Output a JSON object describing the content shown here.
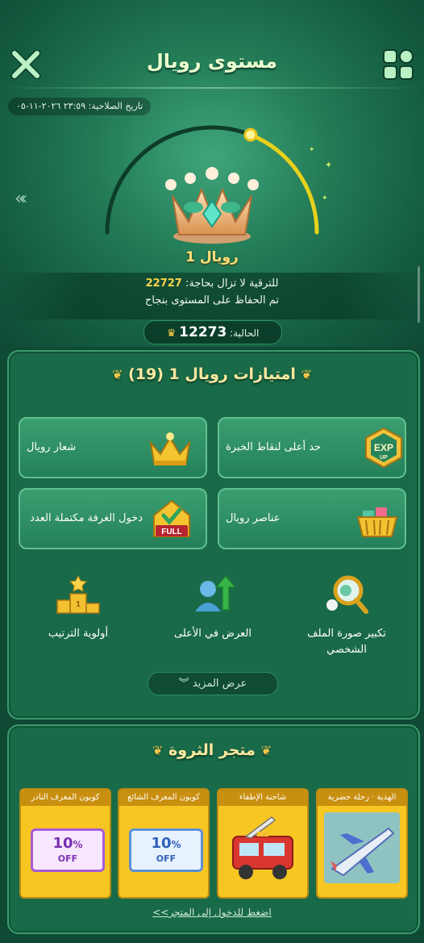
{
  "header": {
    "title": "مستوى رويال"
  },
  "expiry": {
    "text": "تاريخ الصلاحية: ٢٣:٥٩ ٢٠٢٦-١١-٠٥"
  },
  "level": {
    "name": "رويال 1",
    "upgrade_prefix": "للترقية لا تزال بحاجة:",
    "upgrade_needed": "22727",
    "keep_text": "تم الحفاظ على المستوى بنجاح",
    "current_label": "الحالية:",
    "current_value": "12273",
    "progress_fraction": 0.62
  },
  "privileges": {
    "title": "امتيازات رويال 1 (19)",
    "cards": [
      {
        "label": "حد أعلى لنقاط الخبرة",
        "icon": "exp-up-icon"
      },
      {
        "label": "شعار رويال",
        "icon": "crown-badge-icon"
      },
      {
        "label": "عناصر رويال",
        "icon": "basket-icon"
      },
      {
        "label": "دخول الغرفة مكتملة العدد",
        "icon": "full-room-icon"
      }
    ],
    "items": [
      {
        "label": "تكبير صورة الملف الشخصي",
        "icon": "magnifier-icon"
      },
      {
        "label": "العرض في الأعلى",
        "icon": "rank-up-icon"
      },
      {
        "label": "أولوية الترتيب",
        "icon": "podium-icon"
      }
    ],
    "more_label": "عرض المزيد"
  },
  "store": {
    "title": "متجر الثروة",
    "cards": [
      {
        "header": "الهدية · رحلة حضرية",
        "kind": "plane"
      },
      {
        "header": "شاحنة الإطفاء",
        "kind": "truck"
      },
      {
        "header": "كوبون المعرف الشائع",
        "kind": "coupon",
        "pct": "10",
        "pct_sign": "%",
        "off": "OFF"
      },
      {
        "header": "كوبون المعرف النادر",
        "kind": "coupon",
        "pct": "10",
        "pct_sign": "%",
        "off": "OFF"
      }
    ],
    "enter_link": "اضغط للدخول إلى المتجر>>"
  },
  "colors": {
    "accent_gold": "#ffd34a",
    "panel": "#196a48",
    "card_gold": "#f7c623"
  }
}
